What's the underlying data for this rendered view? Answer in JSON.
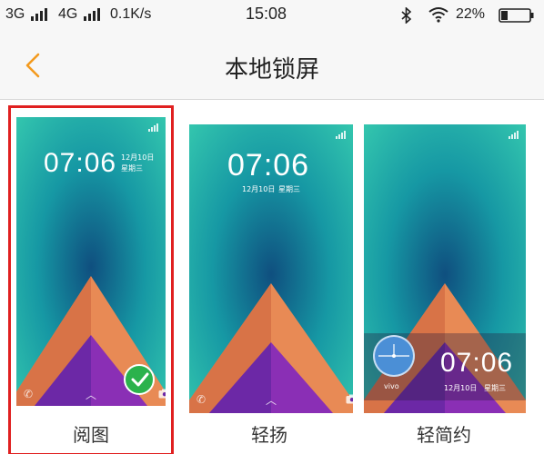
{
  "status_bar": {
    "net1": "3G",
    "net2": "4G",
    "speed": "0.1K/s",
    "time": "15:08",
    "battery": "22%"
  },
  "header": {
    "title": "本地锁屏",
    "back_icon": "chevron-left-icon",
    "accent": "#f39a1e"
  },
  "wallpapers": [
    {
      "name": "阅图",
      "selected": true,
      "clock": "07:06",
      "date": "12月10日",
      "weekday": "星期三"
    },
    {
      "name": "轻扬",
      "selected": false,
      "clock": "07:06",
      "date": "12月10日",
      "weekday": "星期三"
    },
    {
      "name": "轻简约",
      "selected": false,
      "clock": "07:06",
      "date": "12月10日",
      "weekday": "星期三",
      "brand": "vivo"
    }
  ],
  "colors": {
    "selection_border": "#e02020",
    "check_green": "#2bb24c",
    "wallpaper_teal": "#1aa79f"
  }
}
